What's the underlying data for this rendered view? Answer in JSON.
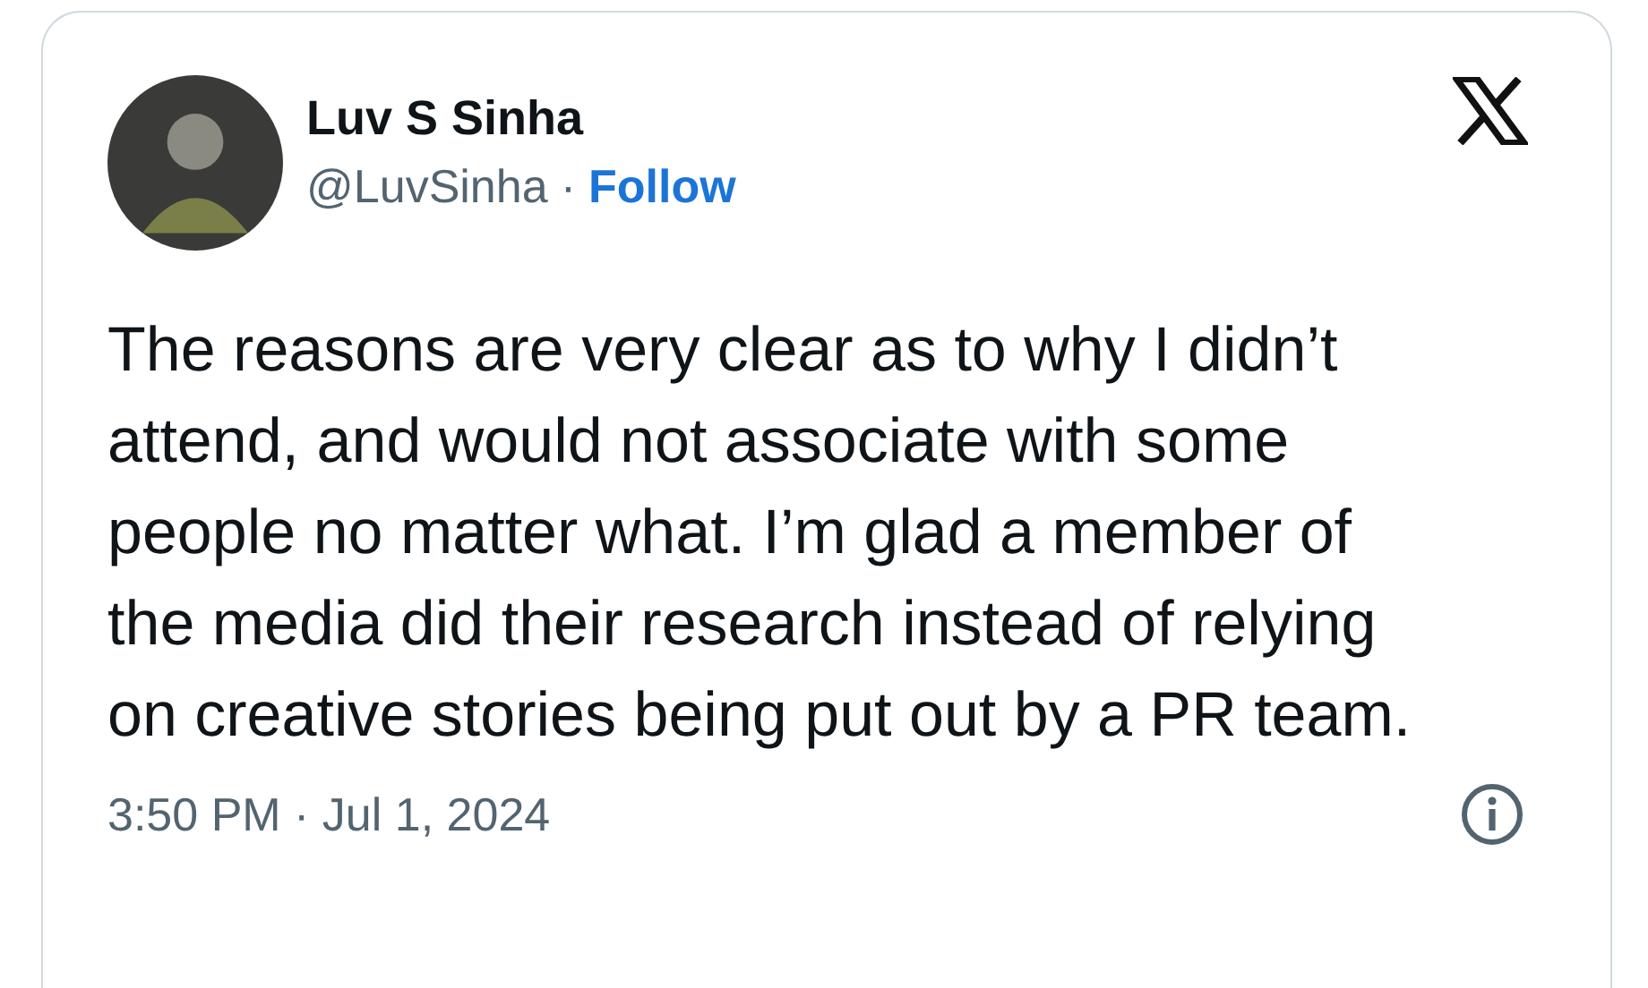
{
  "author": {
    "name": "Luv S Sinha",
    "handle": "@LuvSinha",
    "separator": "·",
    "follow": "Follow"
  },
  "text": "The reasons are very clear as to why I didn’t attend, and would not associate with some people no matter what. I’m glad a member of the media did their research instead of relying on creative stories being put out by a PR team.",
  "timestamp": "3:50 PM · Jul 1, 2024"
}
